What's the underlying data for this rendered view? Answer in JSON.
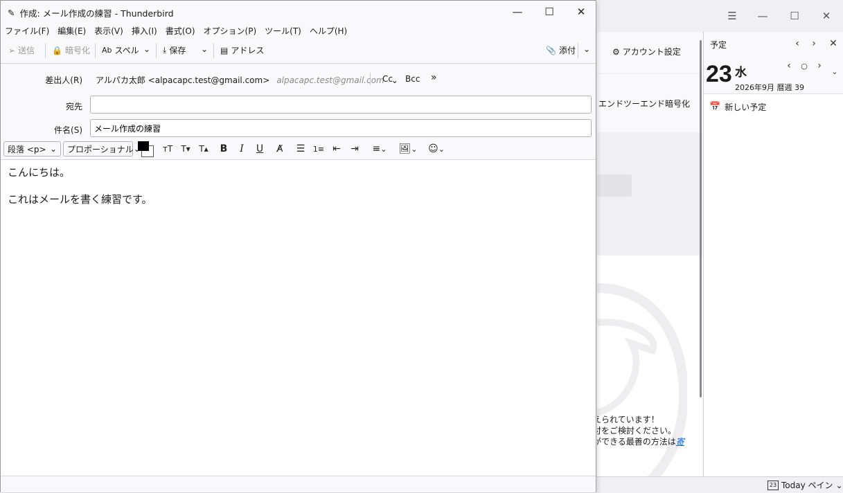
{
  "background": {
    "account_settings": "アカウント設定",
    "e2e_label": "エンドツーエンド暗号化",
    "note_lines": [
      "えられています！",
      "付をご検討ください。"
    ],
    "note_line3_prefix": "ができる最善の方法は",
    "note_line3_link": "寄"
  },
  "today_pane": {
    "title": "予定",
    "day_number": "23",
    "weekday": "水",
    "date_sub": "2026年9月 暦週 39",
    "new_event": "新しい予定",
    "toggle_label": "Today ペイン",
    "toggle_icon_number": "23"
  },
  "compose": {
    "title": "作成: メール作成の練習 - Thunderbird",
    "menu": [
      "ファイル(F)",
      "編集(E)",
      "表示(V)",
      "挿入(I)",
      "書式(O)",
      "オプション(P)",
      "ツール(T)",
      "ヘルプ(H)"
    ],
    "toolbar": {
      "send": "送信",
      "encrypt": "暗号化",
      "spell": "スペル",
      "save": "保存",
      "address": "アドレス",
      "attach": "添付"
    },
    "headers": {
      "from_label": "差出人(R)",
      "from_value": "アルパカ太郎 <alpacapc.test@gmail.com>",
      "from_alt": "alpacapc.test@gmail.com",
      "cc": "Cc",
      "bcc": "Bcc",
      "to_label": "宛先",
      "to_value": "",
      "subject_label": "件名(S)",
      "subject_value": "メール作成の練習"
    },
    "format": {
      "paragraph": "段落 <p>",
      "font": "プロポーショナル",
      "text_color": "#000000"
    },
    "body": [
      "こんにちは。",
      "これはメールを書く練習です。"
    ]
  }
}
